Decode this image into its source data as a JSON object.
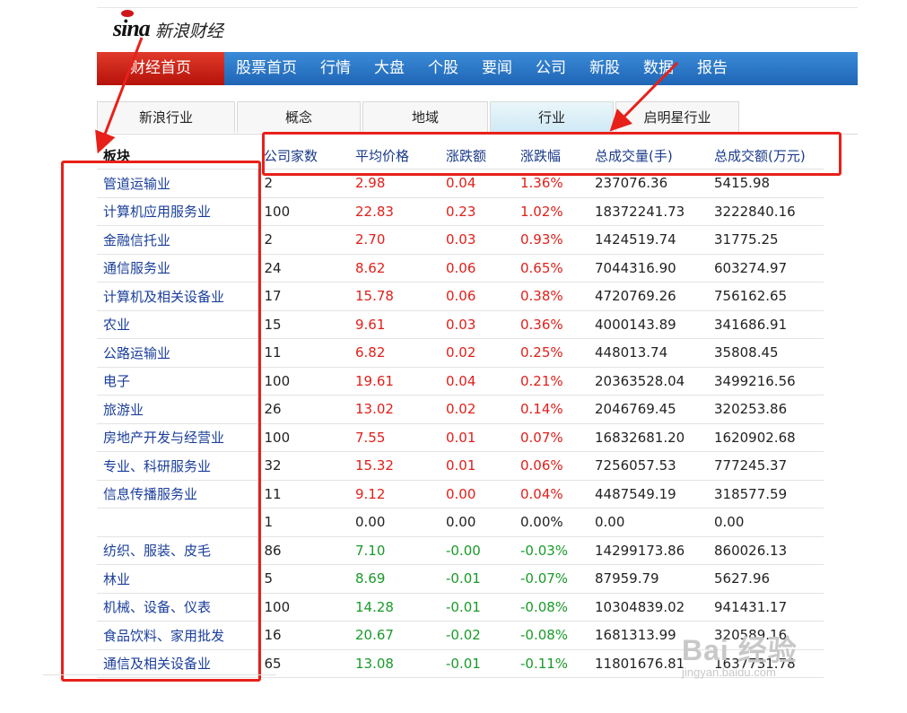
{
  "logo": {
    "brand": "sina",
    "name": "新浪财经"
  },
  "nav": [
    "财经首页",
    "股票首页",
    "行情",
    "大盘",
    "个股",
    "要闻",
    "公司",
    "新股",
    "数据",
    "报告"
  ],
  "subtabs": [
    "新浪行业",
    "概念",
    "地域",
    "行业",
    "启明星行业"
  ],
  "table": {
    "headers": [
      "板块",
      "公司家数",
      "平均价格",
      "涨跌额",
      "涨跌幅",
      "总成交量(手)",
      "总成交额(万元)"
    ],
    "rows": [
      {
        "name": "管道运输业",
        "count": "2",
        "avg": "2.98",
        "chg": "0.04",
        "pct": "1.36%",
        "vol": "237076.36",
        "amt": "5415.98",
        "trend": "up"
      },
      {
        "name": "计算机应用服务业",
        "count": "100",
        "avg": "22.83",
        "chg": "0.23",
        "pct": "1.02%",
        "vol": "18372241.73",
        "amt": "3222840.16",
        "trend": "up"
      },
      {
        "name": "金融信托业",
        "count": "2",
        "avg": "2.70",
        "chg": "0.03",
        "pct": "0.93%",
        "vol": "1424519.74",
        "amt": "31775.25",
        "trend": "up"
      },
      {
        "name": "通信服务业",
        "count": "24",
        "avg": "8.62",
        "chg": "0.06",
        "pct": "0.65%",
        "vol": "7044316.90",
        "amt": "603274.97",
        "trend": "up"
      },
      {
        "name": "计算机及相关设备业",
        "count": "17",
        "avg": "15.78",
        "chg": "0.06",
        "pct": "0.38%",
        "vol": "4720769.26",
        "amt": "756162.65",
        "trend": "up"
      },
      {
        "name": "农业",
        "count": "15",
        "avg": "9.61",
        "chg": "0.03",
        "pct": "0.36%",
        "vol": "4000143.89",
        "amt": "341686.91",
        "trend": "up"
      },
      {
        "name": "公路运输业",
        "count": "11",
        "avg": "6.82",
        "chg": "0.02",
        "pct": "0.25%",
        "vol": "448013.74",
        "amt": "35808.45",
        "trend": "up"
      },
      {
        "name": "电子",
        "count": "100",
        "avg": "19.61",
        "chg": "0.04",
        "pct": "0.21%",
        "vol": "20363528.04",
        "amt": "3499216.56",
        "trend": "up"
      },
      {
        "name": "旅游业",
        "count": "26",
        "avg": "13.02",
        "chg": "0.02",
        "pct": "0.14%",
        "vol": "2046769.45",
        "amt": "320253.86",
        "trend": "up"
      },
      {
        "name": "房地产开发与经营业",
        "count": "100",
        "avg": "7.55",
        "chg": "0.01",
        "pct": "0.07%",
        "vol": "16832681.20",
        "amt": "1620902.68",
        "trend": "up"
      },
      {
        "name": "专业、科研服务业",
        "count": "32",
        "avg": "15.32",
        "chg": "0.01",
        "pct": "0.06%",
        "vol": "7256057.53",
        "amt": "777245.37",
        "trend": "up"
      },
      {
        "name": "信息传播服务业",
        "count": "11",
        "avg": "9.12",
        "chg": "0.00",
        "pct": "0.04%",
        "vol": "4487549.19",
        "amt": "318577.59",
        "trend": "up"
      },
      {
        "name": "",
        "count": "1",
        "avg": "0.00",
        "chg": "0.00",
        "pct": "0.00%",
        "vol": "0.00",
        "amt": "0.00",
        "trend": "flat"
      },
      {
        "name": "纺织、服装、皮毛",
        "count": "86",
        "avg": "7.10",
        "chg": "-0.00",
        "pct": "-0.03%",
        "vol": "14299173.86",
        "amt": "860026.13",
        "trend": "down"
      },
      {
        "name": "林业",
        "count": "5",
        "avg": "8.69",
        "chg": "-0.01",
        "pct": "-0.07%",
        "vol": "87959.79",
        "amt": "5627.96",
        "trend": "down"
      },
      {
        "name": "机械、设备、仪表",
        "count": "100",
        "avg": "14.28",
        "chg": "-0.01",
        "pct": "-0.08%",
        "vol": "10304839.02",
        "amt": "941431.17",
        "trend": "down"
      },
      {
        "name": "食品饮料、家用批发",
        "count": "16",
        "avg": "20.67",
        "chg": "-0.02",
        "pct": "-0.08%",
        "vol": "1681313.99",
        "amt": "320589.16",
        "trend": "down"
      },
      {
        "name": "通信及相关设备业",
        "count": "65",
        "avg": "13.08",
        "chg": "-0.01",
        "pct": "-0.11%",
        "vol": "11801676.81",
        "amt": "1637731.78",
        "trend": "down"
      }
    ]
  },
  "watermark": {
    "line1": "Bai 经验",
    "line2": "jingyan.baidu.com"
  },
  "colors": {
    "up": "#e0201a",
    "down": "#1a9a2a",
    "nav": "#1f66b5",
    "nav_active": "#c8190e",
    "annotation": "#e8201a"
  }
}
